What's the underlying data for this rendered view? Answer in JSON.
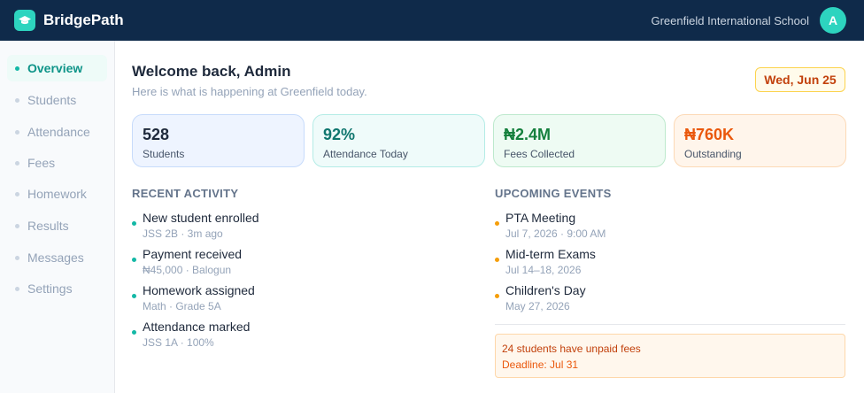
{
  "app": {
    "brand": "BridgePath",
    "school_name": "Greenfield International School",
    "avatar_initial": "A"
  },
  "colors": {
    "brand": "#0f2a4a",
    "accent": "#2dd4bf",
    "warning": "#f59e0b",
    "danger": "#ea580c"
  },
  "sidebar": {
    "items": [
      {
        "label": "Overview",
        "active": true
      },
      {
        "label": "Students",
        "active": false
      },
      {
        "label": "Attendance",
        "active": false
      },
      {
        "label": "Fees",
        "active": false
      },
      {
        "label": "Homework",
        "active": false
      },
      {
        "label": "Results",
        "active": false
      },
      {
        "label": "Messages",
        "active": false
      },
      {
        "label": "Settings",
        "active": false
      }
    ]
  },
  "header": {
    "welcome": "Welcome back, Admin",
    "subtitle": "Here is what is happening at Greenfield today.",
    "date": "Wed, Jun 25"
  },
  "stats": [
    {
      "value": "528",
      "label": "Students"
    },
    {
      "value": "92%",
      "label": "Attendance Today"
    },
    {
      "value": "₦2.4M",
      "label": "Fees Collected"
    },
    {
      "value": "₦760K",
      "label": "Outstanding"
    }
  ],
  "recent_activity": {
    "title": "RECENT ACTIVITY",
    "items": [
      {
        "title": "New student enrolled",
        "detail": "JSS 2B · 3m ago"
      },
      {
        "title": "Payment received",
        "detail": "₦45,000 · Balogun"
      },
      {
        "title": "Homework assigned",
        "detail": "Math · Grade 5A"
      },
      {
        "title": "Attendance marked",
        "detail": "JSS 1A · 100%"
      }
    ]
  },
  "upcoming_events": {
    "title": "UPCOMING EVENTS",
    "items": [
      {
        "title": "PTA Meeting",
        "detail": "Jul 7, 2026 · 9:00 AM"
      },
      {
        "title": "Mid-term Exams",
        "detail": "Jul 14–18, 2026"
      },
      {
        "title": "Children's Day",
        "detail": "May 27, 2026"
      }
    ]
  },
  "alert": {
    "title": "24 students have unpaid fees",
    "deadline": "Deadline: Jul 31"
  }
}
